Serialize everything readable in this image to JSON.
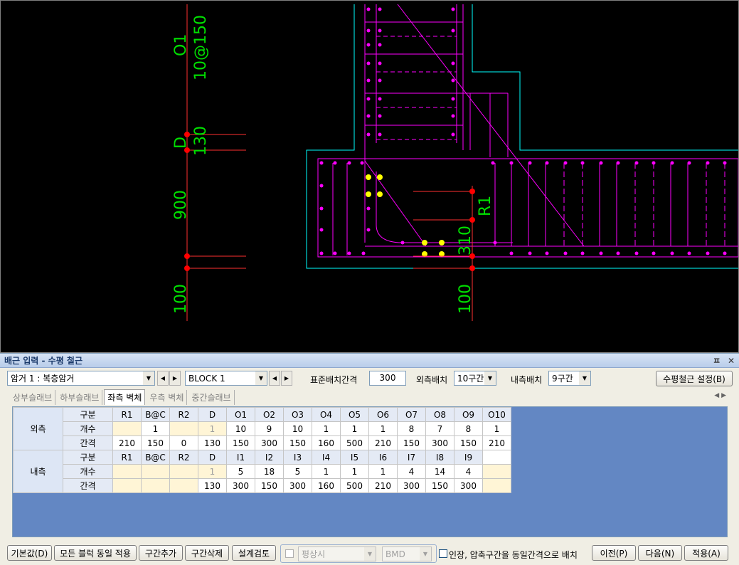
{
  "drawing": {
    "dim_labels_left": [
      "O1",
      "10@150",
      "D",
      "130",
      "900",
      "100"
    ],
    "dim_labels_right": [
      "R1",
      "310",
      "100"
    ]
  },
  "panel": {
    "title": "배근 입력 - 수평 철근",
    "pin": "ㅍ",
    "close": "✕"
  },
  "toolbar": {
    "member_select": "암거 1 : 복층암거",
    "block_select": "BLOCK  1",
    "std_spacing_label": "표준배치간격",
    "std_spacing_value": "300",
    "outer_label": "외측배치",
    "outer_value": "10구간",
    "inner_label": "내측배치",
    "inner_value": "9구간",
    "settings_button": "수평철근 설정(B)"
  },
  "tabs": [
    "상부슬래브",
    "하부슬래브",
    "좌측 벽체",
    "우측 벽체",
    "중간슬래브"
  ],
  "active_tab": "좌측 벽체",
  "grid": {
    "outer_group": "외측",
    "inner_group": "내측",
    "row_labels": [
      "구분",
      "개수",
      "간격"
    ],
    "outer_headers": [
      "R1",
      "B@C",
      "R2",
      "D",
      "O1",
      "O2",
      "O3",
      "O4",
      "O5",
      "O6",
      "O7",
      "O8",
      "O9",
      "O10"
    ],
    "outer_count": [
      "",
      "1",
      "",
      "1",
      "10",
      "9",
      "10",
      "1",
      "1",
      "1",
      "8",
      "7",
      "8",
      "1"
    ],
    "outer_spacing": [
      "210",
      "150",
      "0",
      "130",
      "150",
      "300",
      "150",
      "160",
      "500",
      "210",
      "150",
      "300",
      "150",
      "210"
    ],
    "inner_headers": [
      "R1",
      "B@C",
      "R2",
      "D",
      "I1",
      "I2",
      "I3",
      "I4",
      "I5",
      "I6",
      "I7",
      "I8",
      "I9",
      ""
    ],
    "inner_count": [
      "",
      "",
      "",
      "1",
      "5",
      "18",
      "5",
      "1",
      "1",
      "1",
      "4",
      "14",
      "4",
      ""
    ],
    "inner_spacing": [
      "",
      "",
      "",
      "130",
      "300",
      "150",
      "300",
      "160",
      "500",
      "210",
      "300",
      "150",
      "300",
      ""
    ]
  },
  "bottom": {
    "default_button": "기본값(D)",
    "apply_all_button": "모든 블럭 동일 적용",
    "add_section_button": "구간추가",
    "delete_section_button": "구간삭제",
    "review_button": "설계검토",
    "case_select": "평상시",
    "moment_select": "BMD",
    "equal_spacing_label": "인장, 압축구간을 동일간격으로 배치",
    "prev_button": "이전(P)",
    "next_button": "다음(N)",
    "apply_button": "적용(A)"
  },
  "colors": {
    "dim": "#00ff00",
    "rebar": "#ff00ff",
    "point": "#ff0000",
    "highlight": "#ffff00",
    "outline": "#00ffff"
  }
}
